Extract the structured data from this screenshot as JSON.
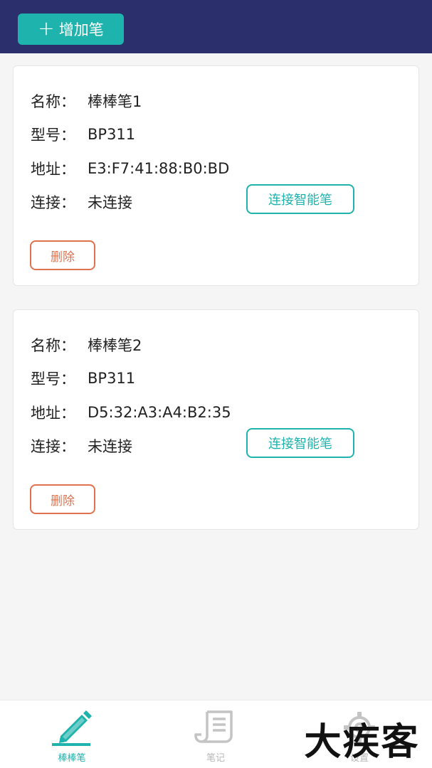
{
  "header": {
    "add_pen_label": "增加笔",
    "add_icon": "plus-icon"
  },
  "labels": {
    "name": "名称：",
    "model": "型号：",
    "address": "地址：",
    "connection": "连接："
  },
  "pens": [
    {
      "name": "棒棒笔1",
      "model": "BP311",
      "address": "E3:F7:41:88:B0:BD",
      "connection": "未连接",
      "connect_label": "连接智能笔",
      "delete_label": "删除"
    },
    {
      "name": "棒棒笔2",
      "model": "BP311",
      "address": "D5:32:A3:A4:B2:35",
      "connection": "未连接",
      "connect_label": "连接智能笔",
      "delete_label": "删除"
    }
  ],
  "tabs": [
    {
      "label": "棒棒笔",
      "icon": "pen-icon",
      "active": true
    },
    {
      "label": "笔记",
      "icon": "scroll-note-icon",
      "active": false
    },
    {
      "label": "设置",
      "icon": "gear-icon",
      "active": false
    }
  ],
  "colors": {
    "header": "#2b2f6b",
    "accent": "#1fb3ad",
    "danger": "#e0734e"
  },
  "watermark": "大疾客"
}
